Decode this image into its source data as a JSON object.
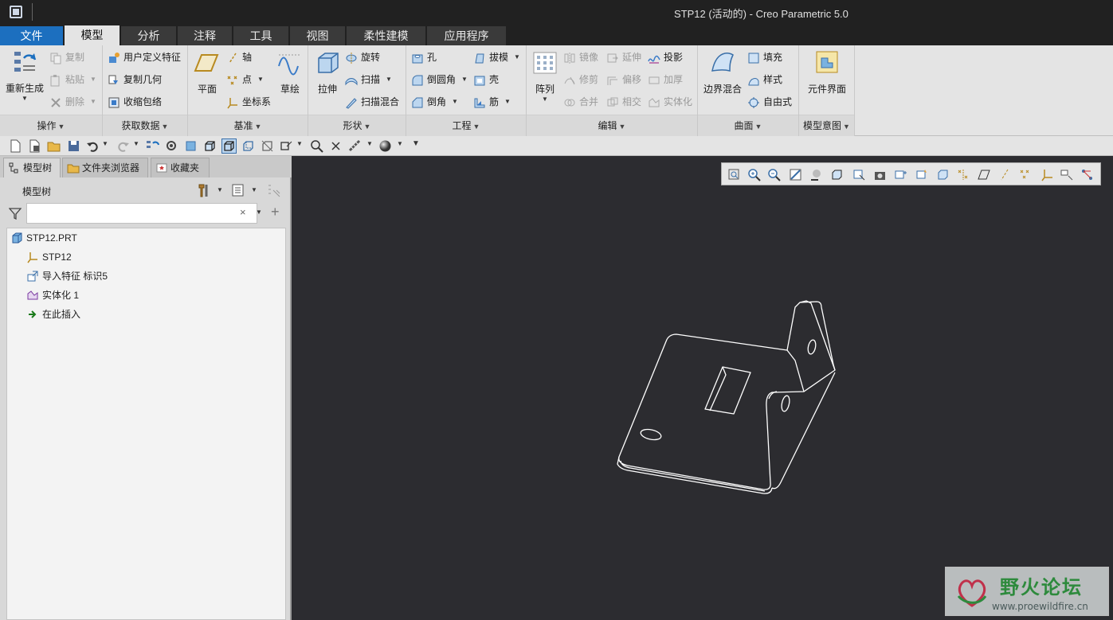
{
  "window": {
    "title": "STP12 (活动的) - Creo Parametric 5.0"
  },
  "tabs": [
    {
      "label": "文件",
      "state": "file"
    },
    {
      "label": "模型",
      "state": "active"
    },
    {
      "label": "分析",
      "state": ""
    },
    {
      "label": "注释",
      "state": ""
    },
    {
      "label": "工具",
      "state": ""
    },
    {
      "label": "视图",
      "state": ""
    },
    {
      "label": "柔性建模",
      "state": ""
    },
    {
      "label": "应用程序",
      "state": ""
    }
  ],
  "ribbon": {
    "operations": {
      "label": "操作",
      "regenerate": "重新生成",
      "copy": "复制",
      "paste": "粘贴",
      "delete": "删除"
    },
    "get_data": {
      "label": "获取数据",
      "udf": "用户定义特征",
      "copy_geom": "复制几何",
      "shrinkwrap": "收缩包络"
    },
    "datum": {
      "label": "基准",
      "plane": "平面",
      "axis": "轴",
      "point": "点",
      "csys": "坐标系",
      "sketch": "草绘"
    },
    "shapes": {
      "label": "形状",
      "extrude": "拉伸",
      "revolve": "旋转",
      "sweep": "扫描",
      "swept_blend": "扫描混合"
    },
    "engineering": {
      "label": "工程",
      "hole": "孔",
      "round": "倒圆角",
      "chamfer": "倒角",
      "draft": "拔模",
      "shell": "壳",
      "rib": "筋"
    },
    "editing": {
      "label": "编辑",
      "pattern": "阵列",
      "mirror": "镜像",
      "extend": "延伸",
      "project": "投影",
      "trim": "修剪",
      "offset": "偏移",
      "thicken": "加厚",
      "merge": "合并",
      "intersect": "相交",
      "solidify": "实体化"
    },
    "surfaces": {
      "label": "曲面",
      "boundary_blend": "边界混合",
      "fill": "填充",
      "style": "样式",
      "freestyle": "自由式"
    },
    "model_intent": {
      "label": "模型意图",
      "component_interface": "元件界面"
    }
  },
  "panel": {
    "tabs": [
      "模型树",
      "文件夹浏览器",
      "收藏夹"
    ],
    "tree_title": "模型树",
    "filter_placeholder": "",
    "tree": [
      {
        "label": "STP12.PRT",
        "icon": "part-icon"
      },
      {
        "label": "STP12",
        "icon": "csys-icon"
      },
      {
        "label": "导入特征 标识5",
        "icon": "import-feature-icon"
      },
      {
        "label": "实体化 1",
        "icon": "solidify-icon"
      },
      {
        "label": "在此插入",
        "icon": "insert-here-arrow-icon"
      }
    ]
  },
  "watermark": {
    "title": "野火论坛",
    "url": "www.proewildfire.cn"
  },
  "colors": {
    "file_tab": "#1c6fbf",
    "viewport_bg": "#2c2c30",
    "ribbon_bg": "#e4e4e4",
    "model_edges": "#ffffff"
  }
}
